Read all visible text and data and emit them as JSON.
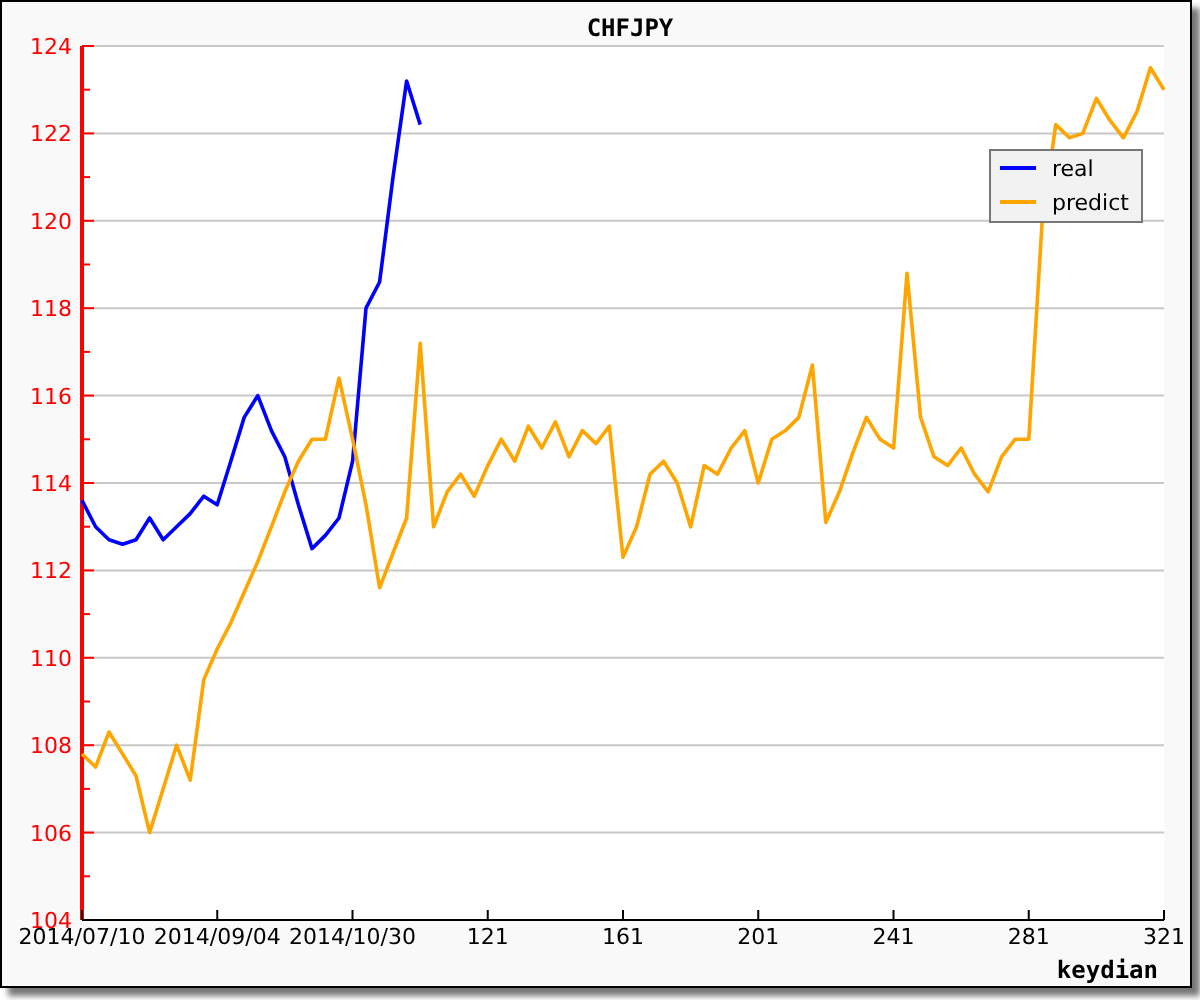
{
  "chart_data": {
    "type": "line",
    "title": "CHFJPY",
    "xlabel": "keydian",
    "x": [
      1,
      5,
      9,
      13,
      17,
      21,
      25,
      29,
      33,
      37,
      41,
      45,
      49,
      53,
      57,
      61,
      65,
      69,
      73,
      77,
      81,
      85,
      89,
      93,
      97,
      101,
      105,
      109,
      113,
      117,
      121,
      125,
      129,
      133,
      137,
      141,
      145,
      149,
      153,
      157,
      161,
      165,
      169,
      173,
      177,
      181,
      185,
      189,
      193,
      197,
      201,
      205,
      209,
      213,
      217,
      221,
      225,
      229,
      233,
      237,
      241,
      245,
      249,
      253,
      257,
      261,
      265,
      269,
      273,
      277,
      281,
      285,
      289,
      293,
      297,
      301,
      305,
      309,
      313,
      317,
      321
    ],
    "series": [
      {
        "name": "real",
        "color": "#0000ff",
        "values": [
          113.6,
          113.0,
          112.7,
          112.6,
          112.7,
          113.2,
          112.7,
          113.0,
          113.3,
          113.7,
          113.5,
          114.5,
          115.5,
          116.0,
          115.2,
          114.6,
          113.5,
          112.5,
          112.8,
          113.2,
          114.5,
          118.0,
          118.6,
          121.0,
          123.2,
          122.2,
          null,
          null,
          null,
          null,
          null,
          null,
          null,
          null,
          null,
          null,
          null,
          null,
          null,
          null,
          null,
          null,
          null,
          null,
          null,
          null,
          null,
          null,
          null,
          null,
          null,
          null,
          null,
          null,
          null,
          null,
          null,
          null,
          null,
          null,
          null,
          null,
          null,
          null,
          null,
          null,
          null,
          null,
          null,
          null,
          null,
          null,
          null,
          null,
          null,
          null,
          null,
          null,
          null,
          null,
          null
        ]
      },
      {
        "name": "predict",
        "color": "#ffa500",
        "values": [
          107.8,
          107.5,
          108.3,
          107.8,
          107.3,
          106.0,
          107.0,
          108.0,
          107.2,
          109.5,
          110.2,
          110.8,
          111.5,
          112.2,
          113.0,
          113.8,
          114.5,
          115.0,
          115.0,
          116.4,
          115.0,
          113.5,
          111.6,
          112.4,
          113.2,
          117.2,
          113.0,
          113.8,
          114.2,
          113.7,
          114.4,
          115.0,
          114.5,
          115.3,
          114.8,
          115.4,
          114.6,
          115.2,
          114.9,
          115.3,
          112.3,
          113.0,
          114.2,
          114.5,
          114.0,
          113.0,
          114.4,
          114.2,
          114.8,
          115.2,
          114.0,
          115.0,
          115.2,
          115.5,
          116.7,
          113.1,
          113.8,
          114.7,
          115.5,
          115.0,
          114.8,
          118.8,
          115.5,
          114.6,
          114.4,
          114.8,
          114.2,
          113.8,
          114.6,
          115.0,
          115.0,
          120.0,
          122.2,
          121.9,
          122.0,
          122.8,
          122.3,
          121.9,
          122.5,
          123.5,
          123.0
        ]
      }
    ],
    "xlim": [
      1,
      321
    ],
    "ylim": [
      104,
      124
    ],
    "grid": true,
    "legend": true,
    "xticks": [
      {
        "value": 1,
        "label": "2014/07/10"
      },
      {
        "value": 41,
        "label": "2014/09/04"
      },
      {
        "value": 81,
        "label": "2014/10/30"
      },
      121,
      161,
      201,
      241,
      281,
      321
    ],
    "yticks": [
      104,
      106,
      108,
      110,
      112,
      114,
      116,
      118,
      120,
      122,
      124
    ]
  }
}
